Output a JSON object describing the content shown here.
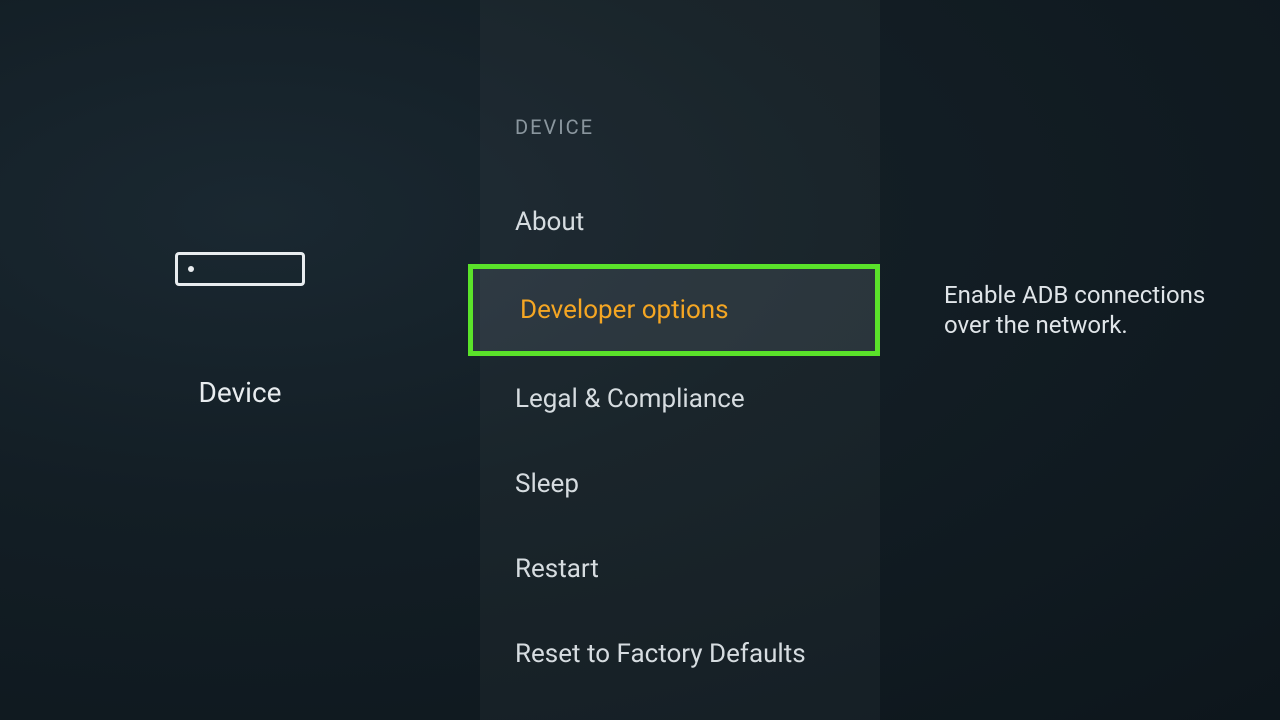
{
  "leftPanel": {
    "title": "Device"
  },
  "centerPanel": {
    "header": "DEVICE",
    "items": [
      {
        "label": "About"
      },
      {
        "label": "Developer options"
      },
      {
        "label": "Legal & Compliance"
      },
      {
        "label": "Sleep"
      },
      {
        "label": "Restart"
      },
      {
        "label": "Reset to Factory Defaults"
      }
    ],
    "selectedIndex": 1
  },
  "rightPanel": {
    "description": "Enable ADB connections over the network."
  }
}
